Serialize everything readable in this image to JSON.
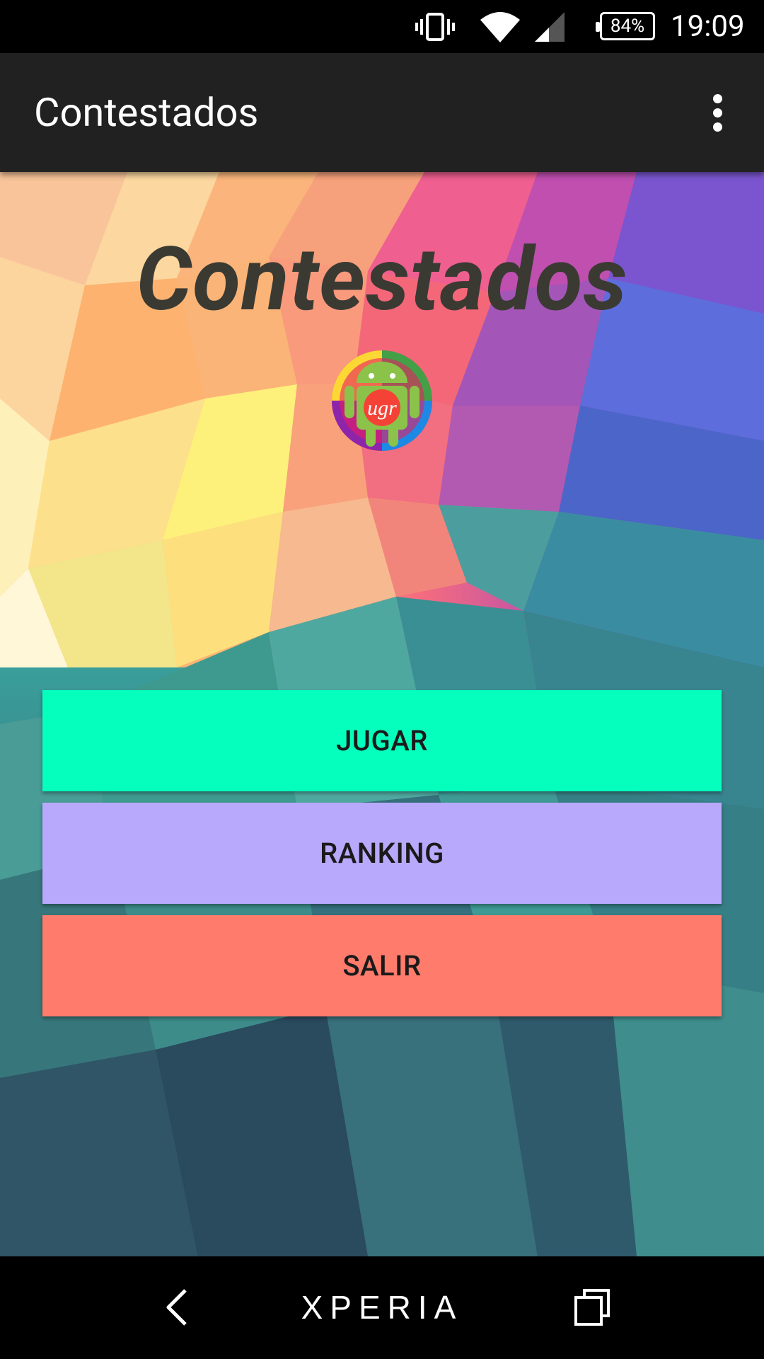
{
  "status_bar": {
    "battery_percent": "84%",
    "time": "19:09",
    "icons": [
      "vibrate-icon",
      "wifi-icon",
      "cell-signal-icon",
      "battery-icon"
    ]
  },
  "app_bar": {
    "title": "Contestados",
    "menu_icon": "overflow-menu-icon"
  },
  "main": {
    "heading": "Contestados",
    "logo_text": "ugr",
    "buttons": {
      "play": "JUGAR",
      "ranking": "RANKING",
      "exit": "SALIR"
    }
  },
  "colors": {
    "play_button": "#05ffbc",
    "ranking_button": "#b8a9fd",
    "exit_button": "#ff7b6c",
    "app_bar": "#212121"
  },
  "nav_bar": {
    "brand": "XPERIA",
    "icons": [
      "back-icon",
      "recent-apps-icon"
    ]
  }
}
